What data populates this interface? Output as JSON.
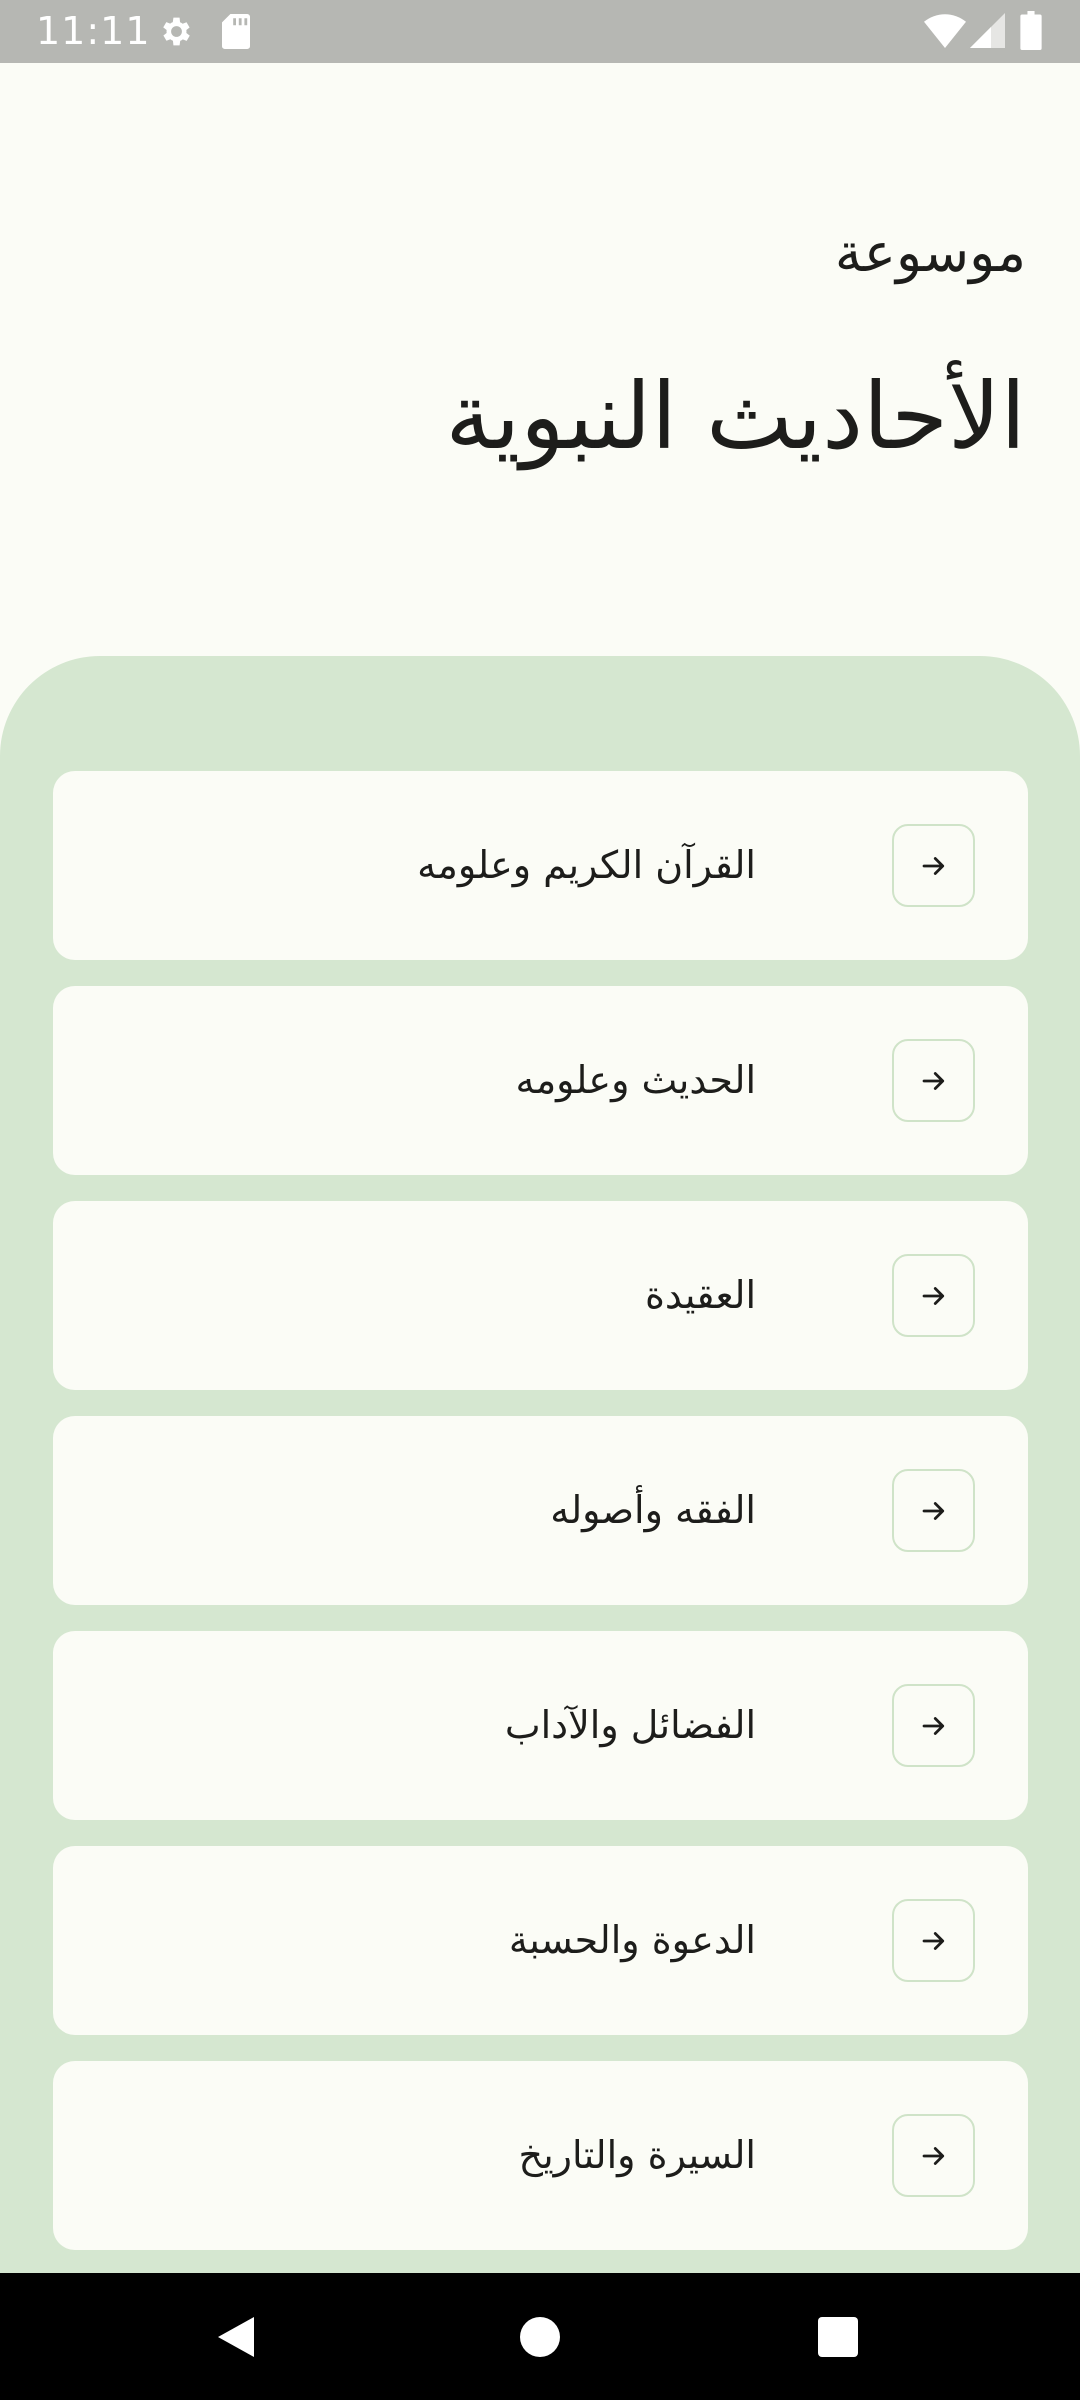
{
  "status_bar": {
    "time": "11:11",
    "icons": [
      "gear-icon",
      "sd-card-icon",
      "wifi-icon",
      "signal-icon",
      "battery-icon"
    ]
  },
  "header": {
    "subtitle": "موسوعة",
    "title": "الأحاديث النبوية"
  },
  "categories": [
    {
      "label": "القرآن الكريم وعلومه",
      "icon": "arrow-right-icon"
    },
    {
      "label": "الحديث وعلومه",
      "icon": "arrow-right-icon"
    },
    {
      "label": "العقيدة",
      "icon": "arrow-right-icon"
    },
    {
      "label": "الفقه وأصوله",
      "icon": "arrow-right-icon"
    },
    {
      "label": "الفضائل والآداب",
      "icon": "arrow-right-icon"
    },
    {
      "label": "الدعوة والحسبة",
      "icon": "arrow-right-icon"
    },
    {
      "label": "السيرة والتاريخ",
      "icon": "arrow-right-icon"
    }
  ],
  "navigation_bar": {
    "buttons": [
      "back-icon",
      "home-icon",
      "recents-icon"
    ]
  },
  "colors": {
    "background": "#fbfcf6",
    "panel": "#d5e7d0",
    "card": "#fbfcf6",
    "button_border": "#cfe3c8",
    "text": "#1d1d1b",
    "status_bar": "#b6b7b3",
    "nav_bar": "#000000"
  }
}
